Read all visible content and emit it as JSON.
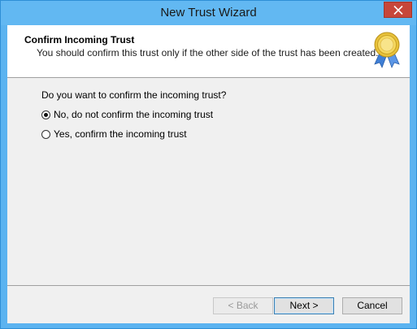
{
  "window": {
    "title": "New Trust Wizard"
  },
  "header": {
    "title": "Confirm Incoming Trust",
    "subtitle": "You should confirm this trust only if the other side of the trust has been created.",
    "icon": "certificate-seal-icon"
  },
  "main": {
    "question": "Do you want to confirm the incoming trust?",
    "options": [
      {
        "label": "No, do not confirm the incoming trust",
        "selected": true
      },
      {
        "label": "Yes, confirm the incoming trust",
        "selected": false
      }
    ]
  },
  "buttons": {
    "back": "< Back",
    "next": "Next >",
    "cancel": "Cancel"
  },
  "colors": {
    "titlebar": "#62b8f2",
    "close": "#c7463a",
    "client_bg": "#f0f0f0"
  }
}
